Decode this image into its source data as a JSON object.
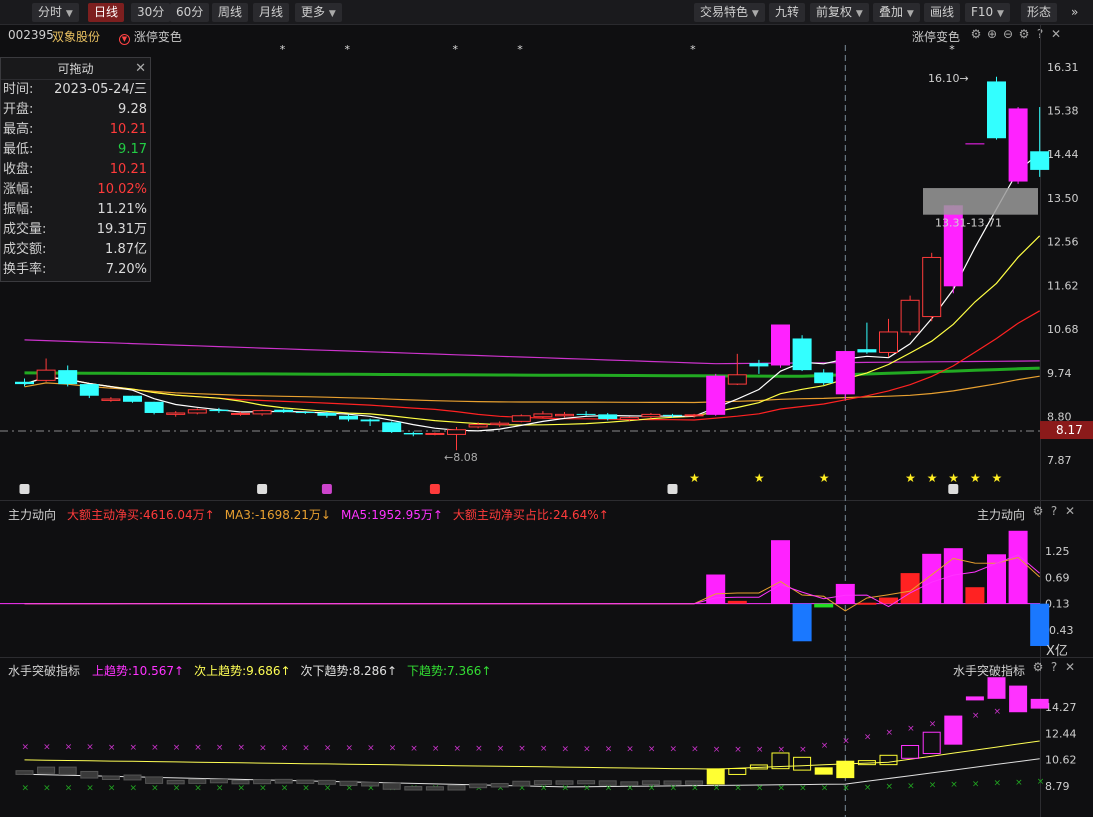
{
  "toolbar": {
    "left": [
      {
        "label": "分时",
        "active": false
      },
      {
        "label": "日线",
        "active": true
      },
      {
        "label": "30分",
        "active": false
      },
      {
        "label": "60分",
        "active": false
      },
      {
        "label": "周线",
        "active": false
      },
      {
        "label": "月线",
        "active": false
      },
      {
        "label": "更多",
        "active": false
      }
    ],
    "right": [
      "交易特色",
      "九转",
      "前复权",
      "叠加",
      "画线",
      "F10",
      "形态"
    ]
  },
  "header": {
    "code": "002395",
    "name": "双象股份",
    "indicator": "涨停变色",
    "right_indicator": "涨停变色"
  },
  "info_box": {
    "title": "可拖动",
    "rows": [
      {
        "k": "时间:",
        "v": "2023-05-24/三",
        "color": "#dcdcdc"
      },
      {
        "k": "开盘:",
        "v": "9.28",
        "color": "#dcdcdc"
      },
      {
        "k": "最高:",
        "v": "10.21",
        "color": "#ff3b3b"
      },
      {
        "k": "最低:",
        "v": "9.17",
        "color": "#22cc44"
      },
      {
        "k": "收盘:",
        "v": "10.21",
        "color": "#ff3b3b"
      },
      {
        "k": "涨幅:",
        "v": "10.02%",
        "color": "#ff3b3b"
      },
      {
        "k": "振幅:",
        "v": "11.21%",
        "color": "#dcdcdc"
      },
      {
        "k": "成交量:",
        "v": "19.31万",
        "color": "#dcdcdc"
      },
      {
        "k": "成交额:",
        "v": "1.87亿",
        "color": "#dcdcdc"
      },
      {
        "k": "换手率:",
        "v": "7.20%",
        "color": "#dcdcdc"
      }
    ]
  },
  "panel2": {
    "title": "主力动向",
    "right_title": "主力动向",
    "legend": [
      {
        "text": "大额主动净买:4616.04万↑",
        "color": "#ff3b3b"
      },
      {
        "text": "MA3:-1698.21万↓",
        "color": "#e8a030"
      },
      {
        "text": "MA5:1952.95万↑",
        "color": "#ff33ff"
      },
      {
        "text": "大额主动净买占比:24.64%↑",
        "color": "#ff3b3b"
      }
    ],
    "unit": "X亿"
  },
  "panel3": {
    "title": "水手突破指标",
    "right_title": "水手突破指标",
    "legend": [
      {
        "text": "上趋势:10.567↑",
        "color": "#ff33ff"
      },
      {
        "text": "次上趋势:9.686↑",
        "color": "#ffff55"
      },
      {
        "text": "次下趋势:8.286↑",
        "color": "#e0e0e0"
      },
      {
        "text": "下趋势:7.366↑",
        "color": "#33dd33"
      }
    ]
  },
  "chart_data": [
    {
      "type": "candlestick",
      "title": "002395 双象股份 日线",
      "y_ticks": [
        "16.31",
        "15.38",
        "14.44",
        "13.50",
        "12.56",
        "11.62",
        "10.68",
        "9.74",
        "8.80",
        "7.87"
      ],
      "y_range": [
        7.87,
        16.31
      ],
      "current_price": "8.17",
      "annotations": {
        "high_label": "16.10",
        "low_label": "8.08",
        "zone_label": "13.31-13.71"
      },
      "up_color": "#ff3b3b",
      "down_color": "#33ffff",
      "limit_up_color": "#ff22ff",
      "candles": [
        {
          "o": 9.55,
          "h": 9.62,
          "l": 9.45,
          "c": 9.5
        },
        {
          "o": 9.58,
          "h": 10.05,
          "l": 9.55,
          "c": 9.8
        },
        {
          "o": 9.8,
          "h": 9.9,
          "l": 9.45,
          "c": 9.5
        },
        {
          "o": 9.5,
          "h": 9.5,
          "l": 9.2,
          "c": 9.25
        },
        {
          "o": 9.15,
          "h": 9.22,
          "l": 9.12,
          "c": 9.18
        },
        {
          "o": 9.25,
          "h": 9.25,
          "l": 9.1,
          "c": 9.12
        },
        {
          "o": 9.12,
          "h": 9.12,
          "l": 8.85,
          "c": 8.88
        },
        {
          "o": 8.85,
          "h": 8.92,
          "l": 8.8,
          "c": 8.88
        },
        {
          "o": 8.88,
          "h": 8.98,
          "l": 8.85,
          "c": 8.95
        },
        {
          "o": 8.95,
          "h": 8.99,
          "l": 8.88,
          "c": 8.92
        },
        {
          "o": 8.85,
          "h": 8.9,
          "l": 8.82,
          "c": 8.87
        },
        {
          "o": 8.86,
          "h": 8.95,
          "l": 8.82,
          "c": 8.93
        },
        {
          "o": 8.95,
          "h": 8.97,
          "l": 8.88,
          "c": 8.9
        },
        {
          "o": 8.9,
          "h": 8.92,
          "l": 8.86,
          "c": 8.88
        },
        {
          "o": 8.88,
          "h": 8.9,
          "l": 8.78,
          "c": 8.82
        },
        {
          "o": 8.82,
          "h": 8.85,
          "l": 8.7,
          "c": 8.74
        },
        {
          "o": 8.74,
          "h": 8.76,
          "l": 8.6,
          "c": 8.7
        },
        {
          "o": 8.68,
          "h": 8.7,
          "l": 8.45,
          "c": 8.47
        },
        {
          "o": 8.45,
          "h": 8.48,
          "l": 8.38,
          "c": 8.42
        },
        {
          "o": 8.42,
          "h": 8.46,
          "l": 8.4,
          "c": 8.44
        },
        {
          "o": 8.42,
          "h": 8.58,
          "l": 8.08,
          "c": 8.52
        },
        {
          "o": 8.58,
          "h": 8.68,
          "l": 8.55,
          "c": 8.63
        },
        {
          "o": 8.63,
          "h": 8.7,
          "l": 8.58,
          "c": 8.66
        },
        {
          "o": 8.7,
          "h": 8.85,
          "l": 8.68,
          "c": 8.82
        },
        {
          "o": 8.8,
          "h": 8.92,
          "l": 8.78,
          "c": 8.86
        },
        {
          "o": 8.82,
          "h": 8.9,
          "l": 8.78,
          "c": 8.85
        },
        {
          "o": 8.86,
          "h": 8.92,
          "l": 8.82,
          "c": 8.85
        },
        {
          "o": 8.85,
          "h": 8.88,
          "l": 8.72,
          "c": 8.75
        },
        {
          "o": 8.74,
          "h": 8.8,
          "l": 8.7,
          "c": 8.78
        },
        {
          "o": 8.8,
          "h": 8.88,
          "l": 8.76,
          "c": 8.85
        },
        {
          "o": 8.84,
          "h": 8.86,
          "l": 8.78,
          "c": 8.82
        },
        {
          "o": 8.82,
          "h": 8.86,
          "l": 8.78,
          "c": 8.84
        },
        {
          "o": 8.84,
          "h": 9.72,
          "l": 8.82,
          "c": 9.68
        },
        {
          "o": 9.5,
          "h": 10.15,
          "l": 9.48,
          "c": 9.7
        },
        {
          "o": 9.95,
          "h": 10.02,
          "l": 9.72,
          "c": 9.88
        },
        {
          "o": 9.9,
          "h": 10.7,
          "l": 9.85,
          "c": 10.78
        },
        {
          "o": 10.48,
          "h": 10.55,
          "l": 9.78,
          "c": 9.8
        },
        {
          "o": 9.75,
          "h": 9.82,
          "l": 9.48,
          "c": 9.52
        },
        {
          "o": 9.28,
          "h": 10.21,
          "l": 9.17,
          "c": 10.21
        },
        {
          "o": 10.25,
          "h": 10.82,
          "l": 10.15,
          "c": 10.18
        },
        {
          "o": 10.18,
          "h": 10.9,
          "l": 10.08,
          "c": 10.62
        },
        {
          "o": 10.62,
          "h": 11.4,
          "l": 10.55,
          "c": 11.3
        },
        {
          "o": 10.95,
          "h": 12.32,
          "l": 10.85,
          "c": 12.22
        },
        {
          "o": 11.6,
          "h": 13.34,
          "l": 11.45,
          "c": 13.34
        },
        {
          "o": 14.67,
          "h": 14.67,
          "l": 14.67,
          "c": 14.67
        },
        {
          "o": 16.0,
          "h": 16.1,
          "l": 14.75,
          "c": 14.78
        },
        {
          "o": 13.85,
          "h": 15.45,
          "l": 13.8,
          "c": 15.42
        },
        {
          "o": 14.5,
          "h": 15.45,
          "l": 13.95,
          "c": 14.1
        }
      ],
      "limit_up_index": [
        32,
        35,
        38,
        43,
        46
      ],
      "ma_lines": [
        {
          "name": "MA5",
          "color": "#ffffff"
        },
        {
          "name": "MA10",
          "color": "#ffff44"
        },
        {
          "name": "MA20",
          "color": "#ff2222"
        },
        {
          "name": "MA60",
          "color": "#e8a030"
        },
        {
          "name": "MA120",
          "color": "#cc33cc"
        },
        {
          "name": "MA250",
          "color": "#22aa22"
        }
      ]
    },
    {
      "type": "bar",
      "title": "主力动向",
      "y_ticks": [
        "1.25",
        "0.69",
        "0.13",
        "-0.43"
      ],
      "y_range": [
        -0.43,
        1.25
      ],
      "unit": "亿",
      "values": [
        0,
        0,
        -0.005,
        0,
        0.005,
        0,
        0,
        0,
        0,
        0,
        0,
        0,
        0,
        0,
        0,
        0,
        0,
        0,
        0,
        0,
        0,
        0,
        0,
        0,
        0,
        0,
        0,
        0,
        0,
        0,
        0,
        0,
        0.62,
        0.06,
        0,
        1.35,
        -0.8,
        -0.08,
        0.42,
        0.02,
        0.13,
        0.65,
        1.06,
        1.18,
        0.35,
        1.05,
        1.55,
        -0.9
      ],
      "bar_colors": [
        "#ff22ff",
        "#ff2222",
        "#1a78ff",
        "#22dd22"
      ]
    },
    {
      "type": "box",
      "title": "水手突破指标",
      "y_ticks": [
        "14.27",
        "12.44",
        "10.62",
        "8.79"
      ],
      "y_range": [
        7.9,
        16.0
      ]
    }
  ]
}
